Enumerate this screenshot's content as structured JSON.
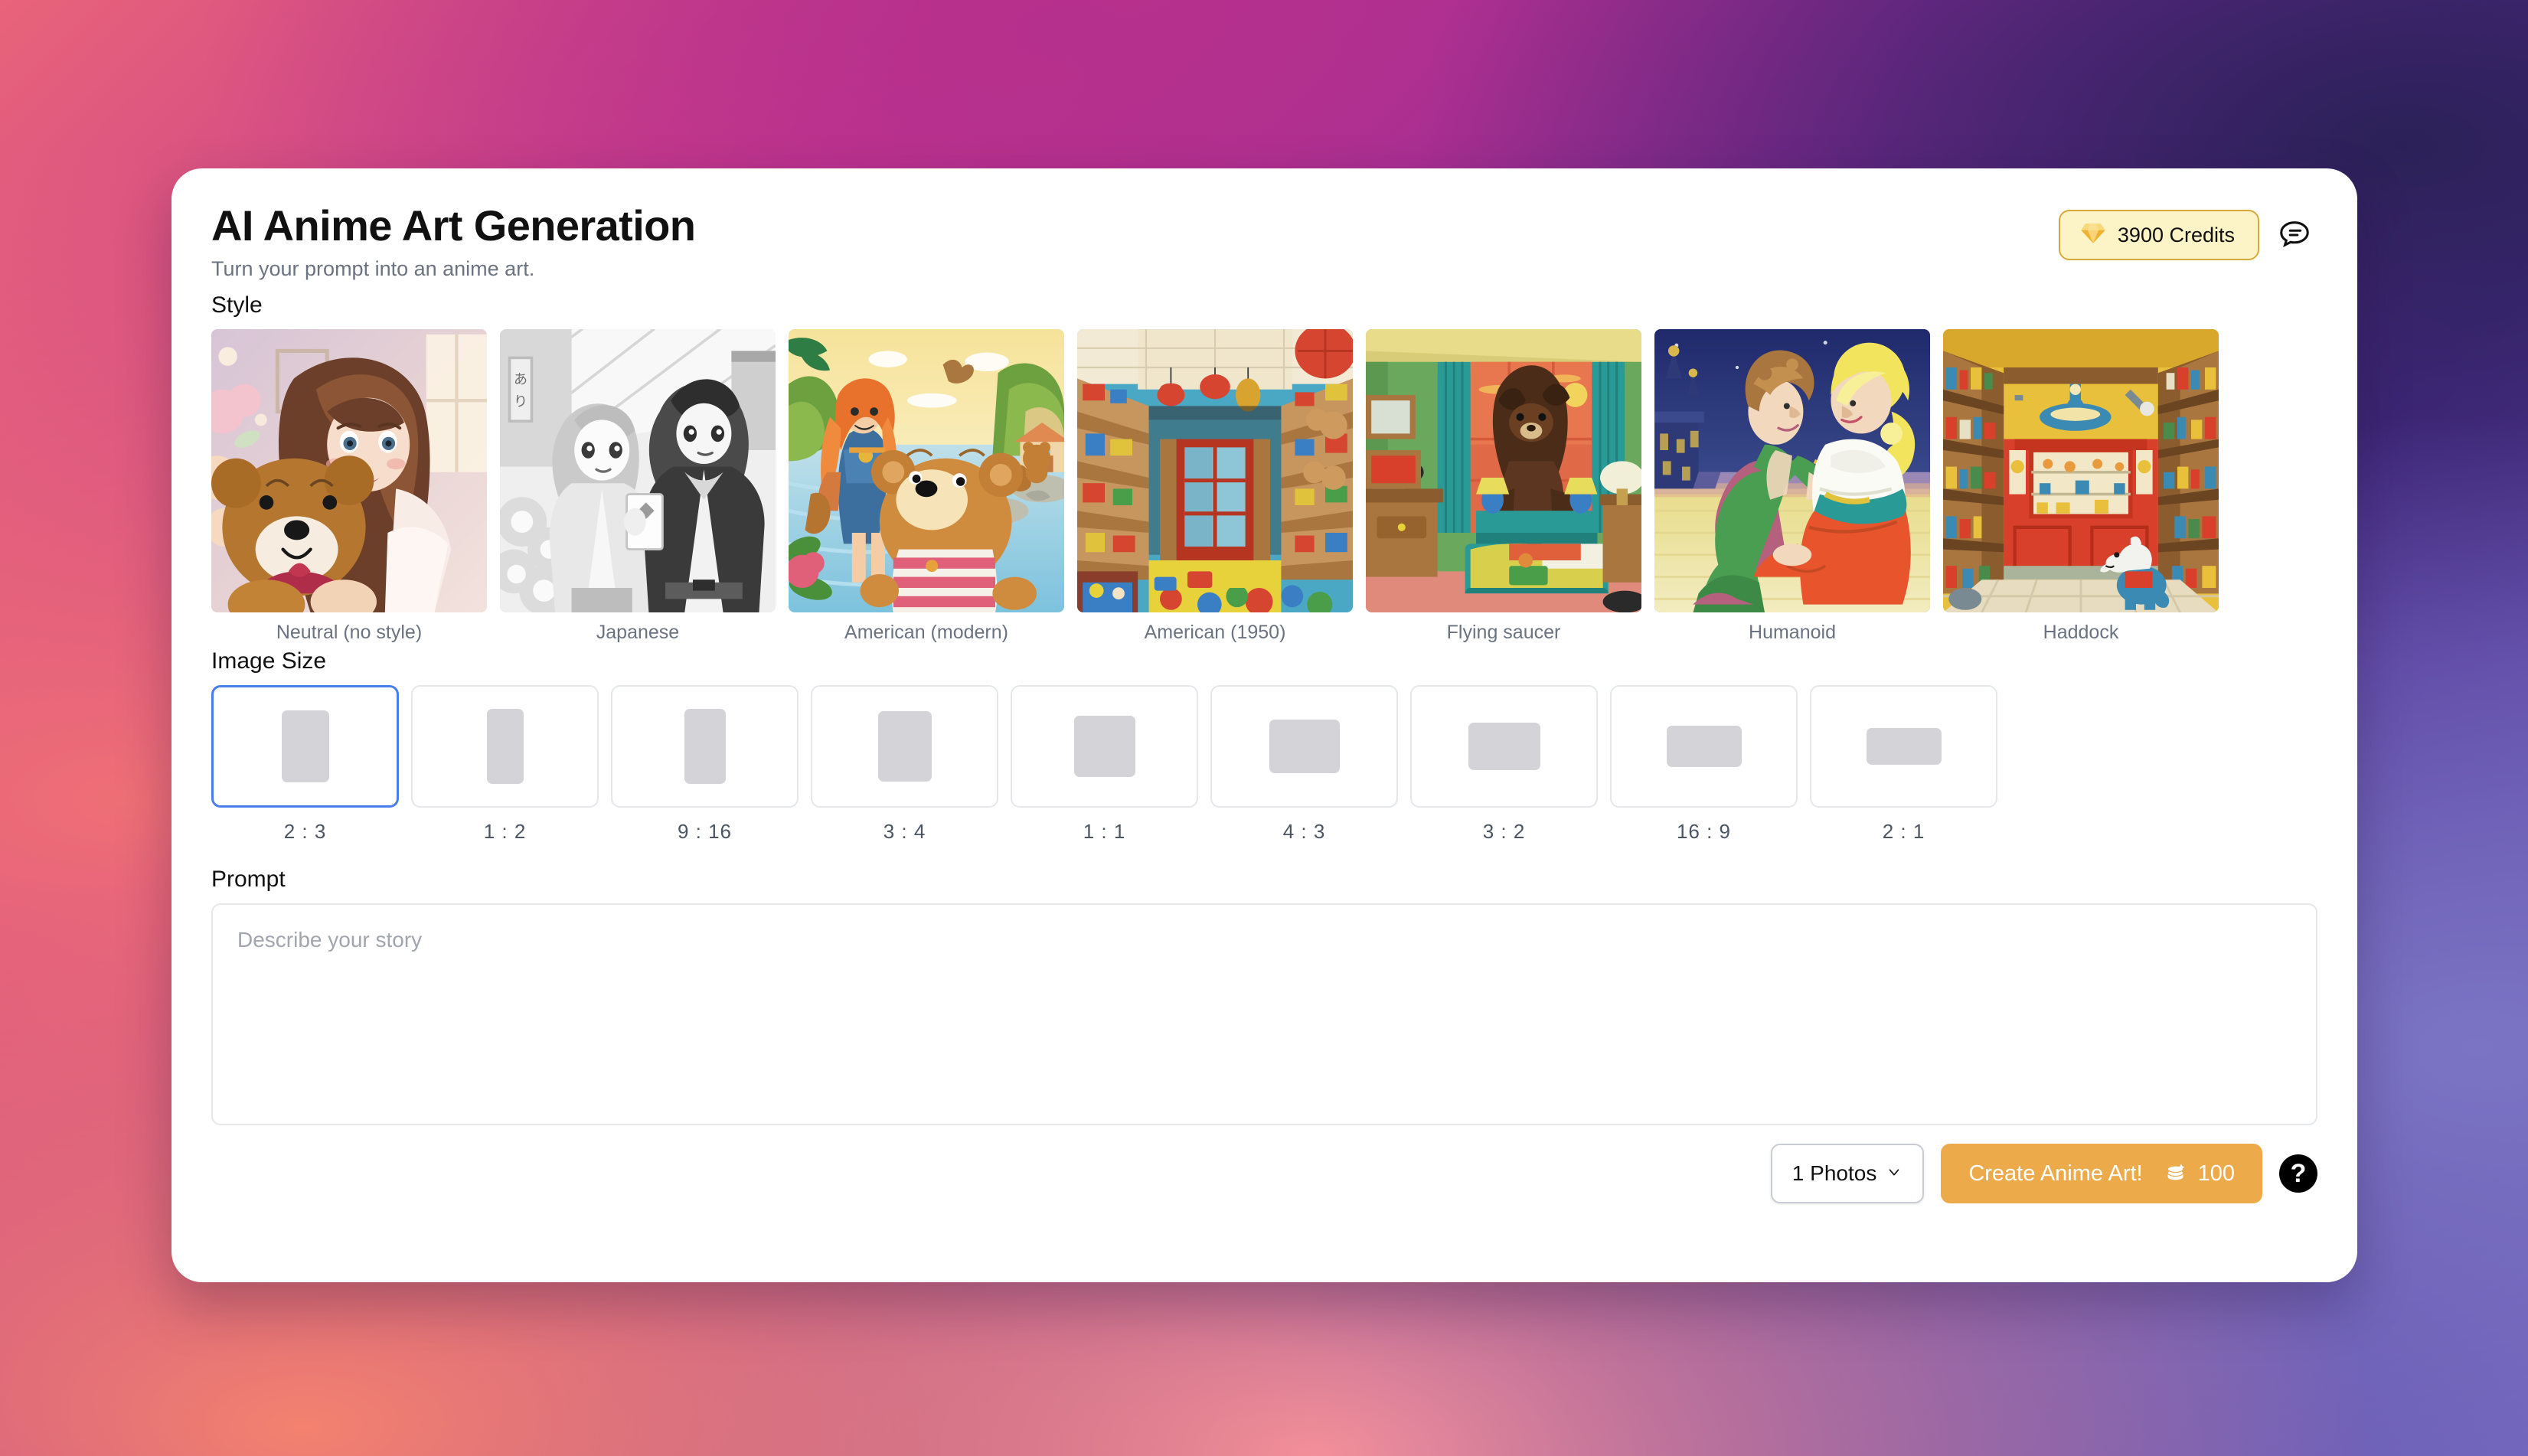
{
  "header": {
    "title": "AI Anime Art Generation",
    "subtitle": "Turn your prompt into an anime art.",
    "credits_label": "3900 Credits",
    "credits_icon": "gem-icon",
    "chat_icon": "chat-bubble-icon",
    "accent_credits_bg": "#fcf3c6",
    "accent_credits_border": "#d8a93a"
  },
  "style_section": {
    "label": "Style",
    "items": [
      {
        "label": "Neutral (no style)",
        "selected": false
      },
      {
        "label": "Japanese",
        "selected": false
      },
      {
        "label": "American (modern)",
        "selected": false
      },
      {
        "label": "American (1950)",
        "selected": false
      },
      {
        "label": "Flying saucer",
        "selected": false
      },
      {
        "label": "Humanoid",
        "selected": false
      },
      {
        "label": "Haddock",
        "selected": false
      }
    ]
  },
  "image_size_section": {
    "label": "Image Size",
    "selected_ratio": "2 : 3",
    "selected_color": "#4a7dec",
    "items": [
      {
        "label": "2 : 3",
        "w": 62,
        "h": 94,
        "selected": true
      },
      {
        "label": "1 : 2",
        "w": 48,
        "h": 98,
        "selected": false
      },
      {
        "label": "9 : 16",
        "w": 54,
        "h": 98,
        "selected": false
      },
      {
        "label": "3 : 4",
        "w": 70,
        "h": 92,
        "selected": false
      },
      {
        "label": "1 : 1",
        "w": 80,
        "h": 80,
        "selected": false
      },
      {
        "label": "4 : 3",
        "w": 92,
        "h": 70,
        "selected": false
      },
      {
        "label": "3 : 2",
        "w": 94,
        "h": 62,
        "selected": false
      },
      {
        "label": "16 : 9",
        "w": 98,
        "h": 54,
        "selected": false
      },
      {
        "label": "2 : 1",
        "w": 98,
        "h": 48,
        "selected": false
      }
    ]
  },
  "prompt_section": {
    "label": "Prompt",
    "placeholder": "Describe your story",
    "value": ""
  },
  "bottom_bar": {
    "photos_label": "1 Photos",
    "photos_chevron": "chevron-down-icon",
    "create_label": "Create Anime Art!",
    "create_cost": "100",
    "coins_icon": "coins-icon",
    "help_label": "?",
    "create_btn_color": "#edaa4a"
  }
}
